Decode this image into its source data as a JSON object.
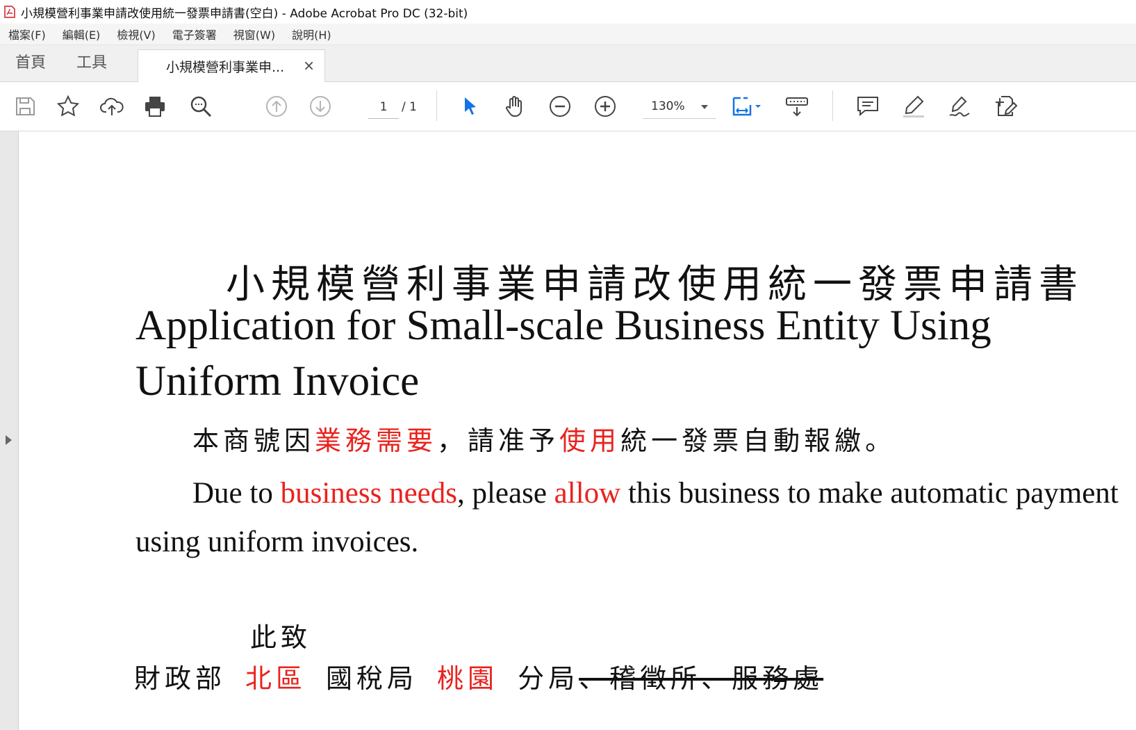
{
  "window": {
    "title": "小規模營利事業申請改使用統一發票申請書(空白) - Adobe Acrobat Pro DC (32-bit)"
  },
  "menu": [
    "檔案(F)",
    "編輯(E)",
    "檢視(V)",
    "電子簽署",
    "視窗(W)",
    "說明(H)"
  ],
  "tabs": {
    "home": "首頁",
    "tools": "工具",
    "document": "小規模營利事業申...",
    "close": "×"
  },
  "toolbar": {
    "page_current": "1",
    "page_total": "/ 1",
    "zoom": "130%"
  },
  "document": {
    "title_zh": "小規模營利事業申請改使用統一發票申請書",
    "title_en": "Application for Small-scale Business Entity Using Uniform Invoice",
    "para_zh": {
      "p1": "本商號因",
      "r1": "業務需要",
      "p2": "，請准予",
      "r2": "使用",
      "p3": "統一發票自動報繳。"
    },
    "para_en": {
      "p1": "Due to ",
      "r1": "business needs",
      "p2": ", please ",
      "r2": "allow",
      "p3": " this business to make automatic payment using uniform invoices."
    },
    "closing": "此致",
    "address": {
      "ministry": "財政部",
      "region": "北區",
      "bureau": "國稅局",
      "branch_name": "桃園",
      "branch": "分局",
      "struck": "、稽徵所、服務處"
    }
  },
  "colors": {
    "highlight_red": "#e8231e",
    "accent_blue": "#1473e6",
    "pdf_red": "#e02020"
  }
}
